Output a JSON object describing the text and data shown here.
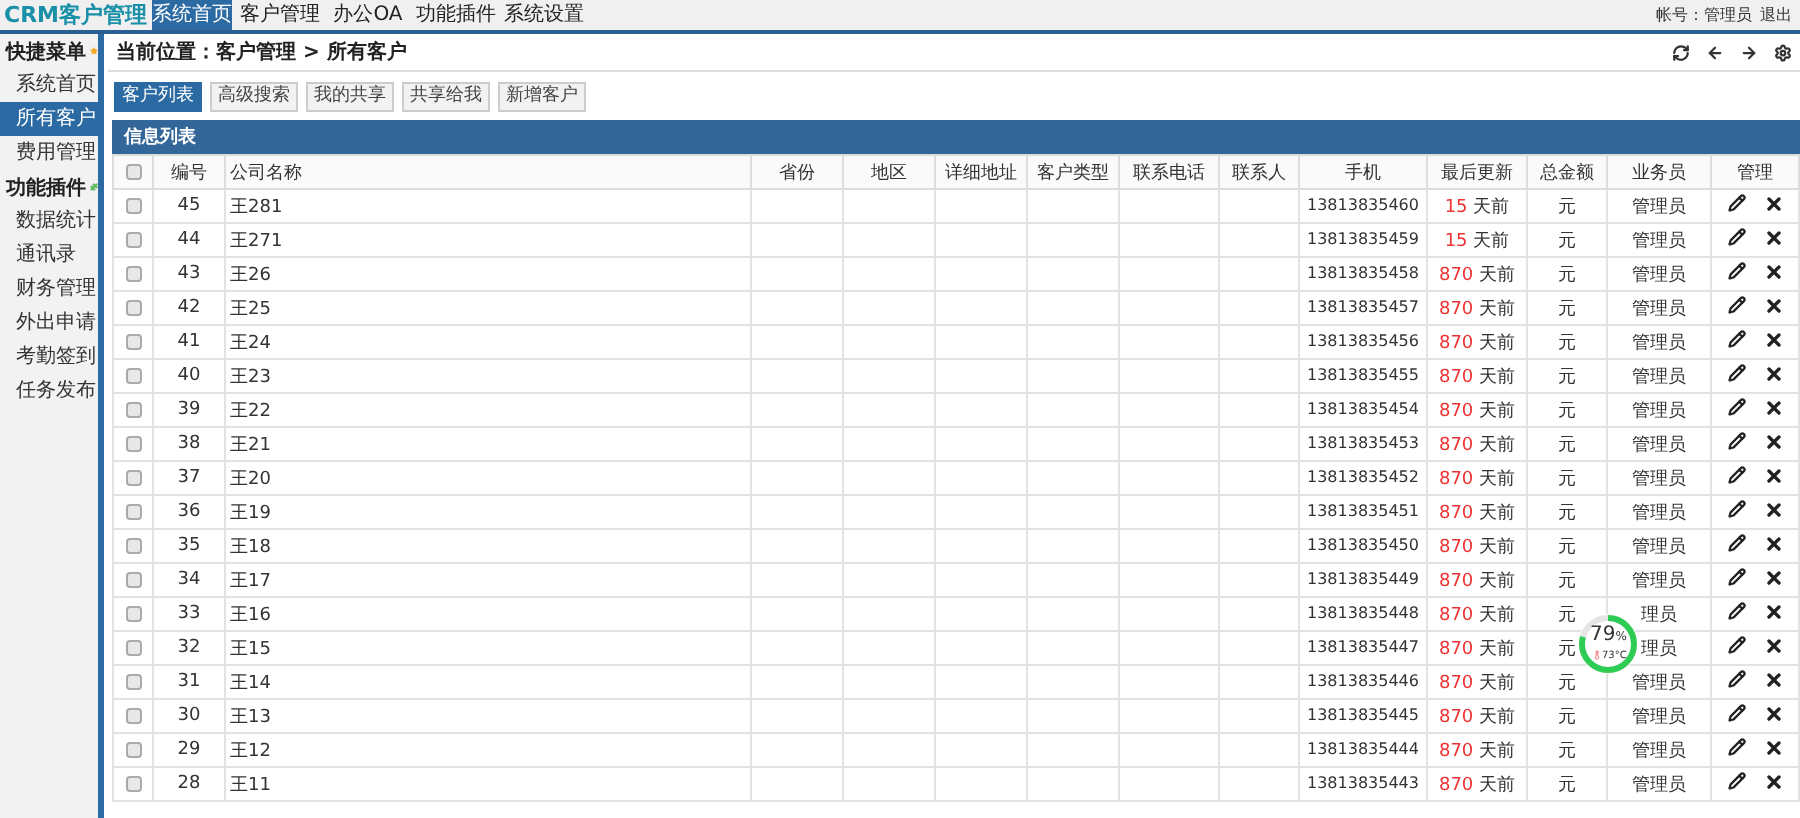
{
  "app": {
    "logo": "CRM客户管理",
    "account": "帐号：管理员",
    "logout": "退出"
  },
  "nav_tabs": [
    {
      "label": "系统首页",
      "selected": true
    },
    {
      "label": "客户管理",
      "selected": false
    },
    {
      "label": "办公OA",
      "selected": false
    },
    {
      "label": "功能插件",
      "selected": false
    },
    {
      "label": "系统设置",
      "selected": false
    }
  ],
  "sidebar": [
    {
      "kind": "heading",
      "label": "快捷菜单"
    },
    {
      "kind": "item",
      "label": "系统首页",
      "selected": false
    },
    {
      "kind": "item",
      "label": "所有客户",
      "selected": true
    },
    {
      "kind": "item",
      "label": "费用管理",
      "selected": false
    },
    {
      "kind": "heading",
      "label": "功能插件"
    },
    {
      "kind": "item",
      "label": "数据统计",
      "selected": false
    },
    {
      "kind": "item",
      "label": "通讯录",
      "selected": false
    },
    {
      "kind": "item",
      "label": "财务管理",
      "selected": false
    },
    {
      "kind": "item",
      "label": "外出申请",
      "selected": false
    },
    {
      "kind": "item",
      "label": "考勤签到",
      "selected": false
    },
    {
      "kind": "item",
      "label": "任务发布",
      "selected": false
    }
  ],
  "breadcrumb": "当前位置：客户管理 > 所有客户",
  "toolbar": [
    {
      "label": "客户列表",
      "selected": true
    },
    {
      "label": "高级搜索",
      "selected": false
    },
    {
      "label": "我的共享",
      "selected": false
    },
    {
      "label": "共享给我",
      "selected": false
    },
    {
      "label": "新增客户",
      "selected": false
    }
  ],
  "panel_title": "信息列表",
  "table": {
    "header_checked": false,
    "columns": [
      "编号",
      "公司名称",
      "省份",
      "地区",
      "详细地址",
      "客户类型",
      "联系电话",
      "联系人",
      "手机",
      "最后更新",
      "总金额",
      "业务员",
      "管理"
    ],
    "rows": [
      {
        "checked": false,
        "id": "45",
        "name": "王281",
        "mobile": "13813835460",
        "days": "15",
        "days_unit": "天前",
        "amount": "元",
        "salesman": "管理员"
      },
      {
        "checked": false,
        "id": "44",
        "name": "王271",
        "mobile": "13813835459",
        "days": "15",
        "days_unit": "天前",
        "amount": "元",
        "salesman": "管理员"
      },
      {
        "checked": false,
        "id": "43",
        "name": "王26",
        "mobile": "13813835458",
        "days": "870",
        "days_unit": "天前",
        "amount": "元",
        "salesman": "管理员"
      },
      {
        "checked": false,
        "id": "42",
        "name": "王25",
        "mobile": "13813835457",
        "days": "870",
        "days_unit": "天前",
        "amount": "元",
        "salesman": "管理员"
      },
      {
        "checked": false,
        "id": "41",
        "name": "王24",
        "mobile": "13813835456",
        "days": "870",
        "days_unit": "天前",
        "amount": "元",
        "salesman": "管理员"
      },
      {
        "checked": false,
        "id": "40",
        "name": "王23",
        "mobile": "13813835455",
        "days": "870",
        "days_unit": "天前",
        "amount": "元",
        "salesman": "管理员"
      },
      {
        "checked": false,
        "id": "39",
        "name": "王22",
        "mobile": "13813835454",
        "days": "870",
        "days_unit": "天前",
        "amount": "元",
        "salesman": "管理员"
      },
      {
        "checked": false,
        "id": "38",
        "name": "王21",
        "mobile": "13813835453",
        "days": "870",
        "days_unit": "天前",
        "amount": "元",
        "salesman": "管理员"
      },
      {
        "checked": false,
        "id": "37",
        "name": "王20",
        "mobile": "13813835452",
        "days": "870",
        "days_unit": "天前",
        "amount": "元",
        "salesman": "管理员"
      },
      {
        "checked": false,
        "id": "36",
        "name": "王19",
        "mobile": "13813835451",
        "days": "870",
        "days_unit": "天前",
        "amount": "元",
        "salesman": "管理员"
      },
      {
        "checked": false,
        "id": "35",
        "name": "王18",
        "mobile": "13813835450",
        "days": "870",
        "days_unit": "天前",
        "amount": "元",
        "salesman": "管理员"
      },
      {
        "checked": false,
        "id": "34",
        "name": "王17",
        "mobile": "13813835449",
        "days": "870",
        "days_unit": "天前",
        "amount": "元",
        "salesman": "管理员"
      },
      {
        "checked": false,
        "id": "33",
        "name": "王16",
        "mobile": "13813835448",
        "days": "870",
        "days_unit": "天前",
        "amount": "元",
        "salesman": "理员"
      },
      {
        "checked": false,
        "id": "32",
        "name": "王15",
        "mobile": "13813835447",
        "days": "870",
        "days_unit": "天前",
        "amount": "元",
        "salesman": "理员"
      },
      {
        "checked": false,
        "id": "31",
        "name": "王14",
        "mobile": "13813835446",
        "days": "870",
        "days_unit": "天前",
        "amount": "元",
        "salesman": "管理员"
      },
      {
        "checked": false,
        "id": "30",
        "name": "王13",
        "mobile": "13813835445",
        "days": "870",
        "days_unit": "天前",
        "amount": "元",
        "salesman": "管理员"
      },
      {
        "checked": false,
        "id": "29",
        "name": "王12",
        "mobile": "13813835444",
        "days": "870",
        "days_unit": "天前",
        "amount": "元",
        "salesman": "管理员"
      },
      {
        "checked": false,
        "id": "28",
        "name": "王11",
        "mobile": "13813835443",
        "days": "870",
        "days_unit": "天前",
        "amount": "元",
        "salesman": "管理员"
      }
    ]
  },
  "monitor": {
    "percent": "79",
    "unit": "%",
    "temperature": "73°C",
    "level": 0.79
  }
}
